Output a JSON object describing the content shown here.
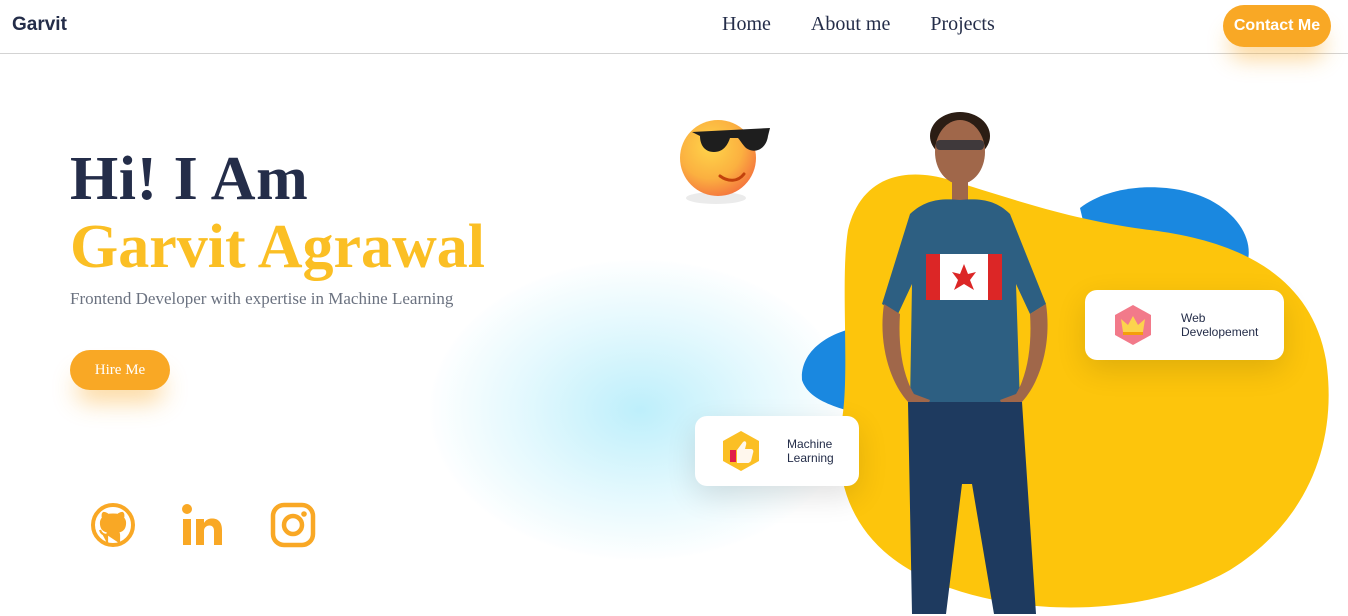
{
  "navbar": {
    "brand": "Garvit",
    "links": [
      "Home",
      "About me",
      "Projects"
    ],
    "contact_label": "Contact Me"
  },
  "hero": {
    "greeting": "Hi! I Am",
    "name": "Garvit Agrawal",
    "tagline": "Frontend Developer with expertise in Machine Learning",
    "hire_label": "Hire Me"
  },
  "socials": [
    {
      "icon": "github-icon"
    },
    {
      "icon": "linkedin-icon"
    },
    {
      "icon": "instagram-icon"
    }
  ],
  "cards": {
    "web": {
      "line1": "Web",
      "line2": "Developement",
      "icon": "crown-icon"
    },
    "ml": {
      "line1": "Machine",
      "line2": "Learning",
      "icon": "thumbs-up-icon"
    }
  },
  "colors": {
    "accent": "#f9a825",
    "name_yellow": "#fbbf24",
    "heading": "#242d49",
    "blob_yellow": "#fdc50c",
    "blob_blue": "#1a88e0"
  }
}
